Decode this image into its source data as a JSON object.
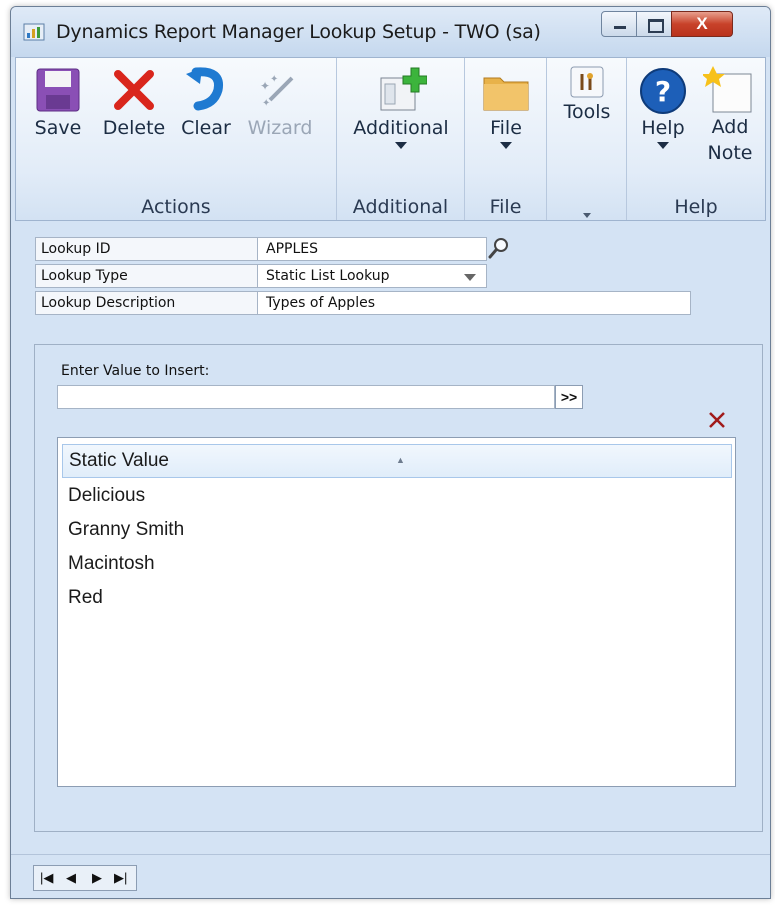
{
  "window": {
    "title": "Dynamics Report Manager Lookup Setup  -  TWO (sa)",
    "close_glyph": "X"
  },
  "ribbon": {
    "groups": {
      "actions": "Actions",
      "additional": "Additional",
      "file": "File",
      "tools": "",
      "help": "Help"
    },
    "buttons": {
      "save": "Save",
      "delete": "Delete",
      "clear": "Clear",
      "wizard": "Wizard",
      "additional": "Additional",
      "file": "File",
      "tools": "Tools",
      "help": "Help",
      "add_note": "Add Note"
    }
  },
  "form": {
    "lookup_id_label": "Lookup ID",
    "lookup_id_value": "APPLES",
    "lookup_type_label": "Lookup Type",
    "lookup_type_value": "Static List Lookup",
    "lookup_description_label": "Lookup Description",
    "lookup_description_value": "Types of Apples",
    "enter_value_label": "Enter Value to Insert:",
    "enter_value": "",
    "insert_button": ">>"
  },
  "list": {
    "header": "Static Value",
    "rows": [
      "Delicious",
      "Granny Smith",
      "Macintosh",
      "Red"
    ]
  },
  "icons": [
    "app-icon",
    "save-icon",
    "delete-icon",
    "clear-icon",
    "wizard-icon",
    "additional-icon",
    "file-icon",
    "tools-icon",
    "help-icon",
    "add-note-icon",
    "search-icon",
    "dropdown-icon",
    "remove-icon"
  ]
}
